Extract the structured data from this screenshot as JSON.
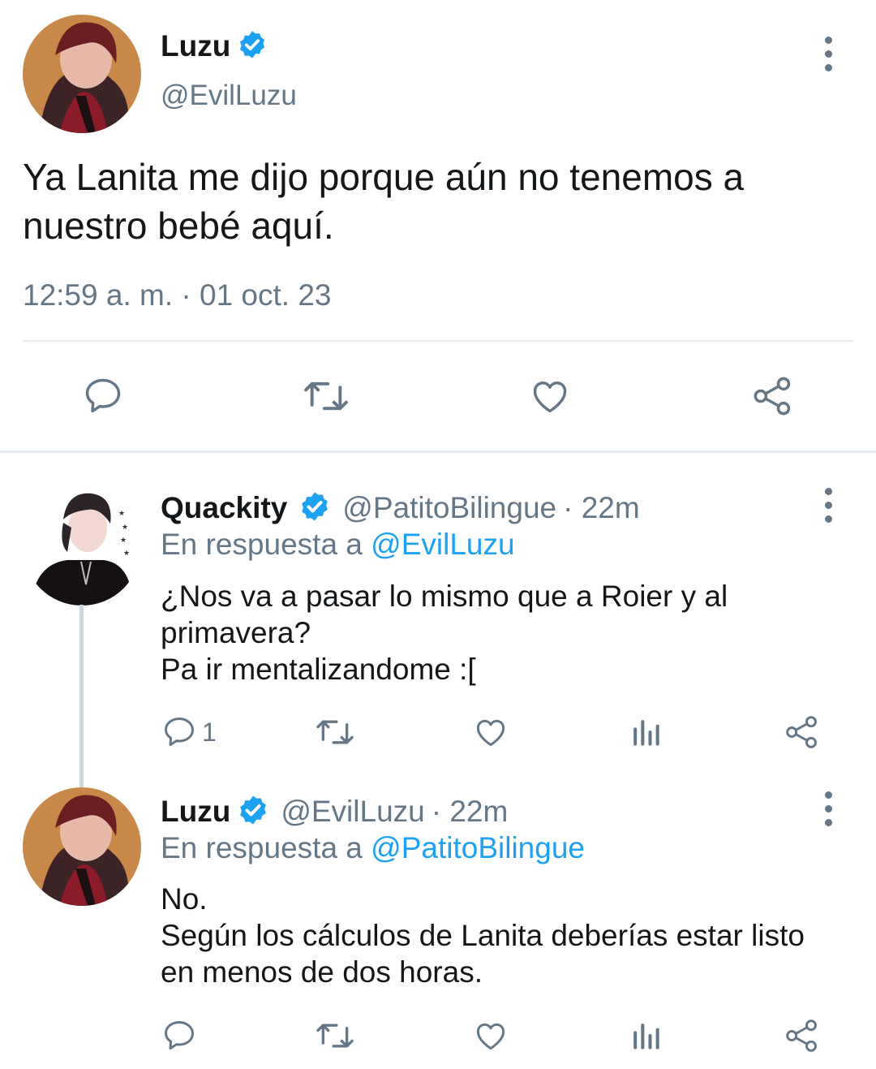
{
  "main_tweet": {
    "name": "Luzu",
    "handle": "@EvilLuzu",
    "text_line1": "Ya Lanita me dijo porque aún no tenemos a",
    "text_line2": "nuestro bebé aquí.",
    "timestamp": "12:59 a. m. · 01 oct. 23"
  },
  "reply1": {
    "name": "Quackity",
    "handle": "@PatitoBilingue",
    "age": "· 22m",
    "reply_prefix": "En respuesta a",
    "reply_to": "@EvilLuzu",
    "line1": "¿Nos va a pasar lo mismo que a Roier y al",
    "line2": "primavera?",
    "line3": "Pa ir mentalizandome :[",
    "reply_count": "1"
  },
  "reply2": {
    "name": "Luzu",
    "handle": "@EvilLuzu",
    "age": "· 22m",
    "reply_prefix": "En respuesta a",
    "reply_to": "@PatitoBilingue",
    "line1": "No.",
    "line2": "Según los cálculos de Lanita deberías estar listo",
    "line3": "en menos de dos horas."
  },
  "colors": {
    "accent": "#1da1f2",
    "muted": "#657786",
    "divider": "#e6ecf0"
  }
}
